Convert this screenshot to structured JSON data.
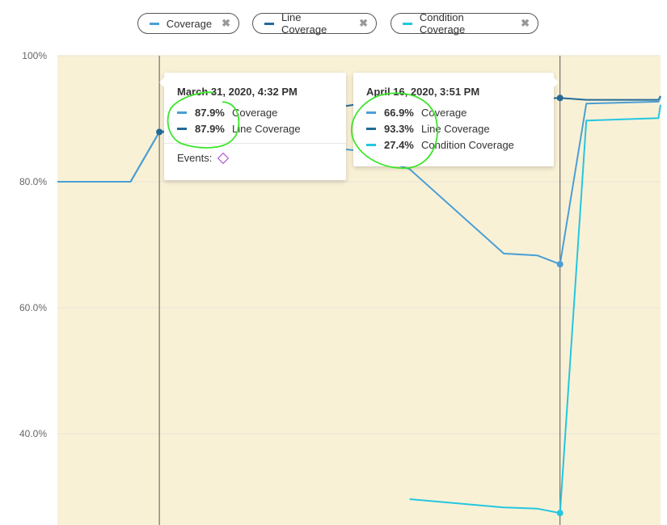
{
  "legend": [
    {
      "label": "Coverage",
      "color": "#4b9fd5",
      "remove_icon": "close-icon"
    },
    {
      "label": "Line Coverage",
      "color": "#236a97",
      "remove_icon": "close-icon"
    },
    {
      "label": "Condition Coverage",
      "color": "#24c6e0",
      "remove_icon": "close-icon"
    }
  ],
  "close_glyph": "✖",
  "tooltips": [
    {
      "date": "March 31, 2020, 4:32 PM",
      "rows": [
        {
          "value": "87.9%",
          "label": "Coverage",
          "color": "#4b9fd5"
        },
        {
          "value": "87.9%",
          "label": "Line Coverage",
          "color": "#236a97"
        }
      ],
      "events_label": "Events:",
      "event_icon": "diamond-icon"
    },
    {
      "date": "April 16, 2020, 3:51 PM",
      "rows": [
        {
          "value": "66.9%",
          "label": "Coverage",
          "color": "#4b9fd5"
        },
        {
          "value": "93.3%",
          "label": "Line Coverage",
          "color": "#236a97"
        },
        {
          "value": "27.4%",
          "label": "Condition Coverage",
          "color": "#24c6e0"
        }
      ]
    }
  ],
  "chart_data": {
    "type": "line",
    "background": "#f9f1d6",
    "ylim": [
      25.5,
      100
    ],
    "xlim": [
      "2020-03-27T15:00",
      "2020-04-20T16:00"
    ],
    "yticks": [
      {
        "value": 100,
        "label": "100%"
      },
      {
        "value": 80,
        "label": "80.0%"
      },
      {
        "value": 60,
        "label": "60.0%"
      },
      {
        "value": 40,
        "label": "40.0%"
      }
    ],
    "grid": true,
    "hover_dates": [
      "2020-03-31T16:32",
      "2020-04-16T15:51"
    ],
    "series": [
      {
        "name": "Line Coverage",
        "color": "#236a97",
        "points": [
          [
            "2020-03-27T15:00",
            80.0
          ],
          [
            "2020-03-30T13:00",
            80.0
          ],
          [
            "2020-03-31T16:32",
            87.9
          ],
          [
            "2020-04-08T11:00",
            92.2
          ],
          [
            "2020-04-16T15:51",
            93.3
          ],
          [
            "2020-04-17T17:00",
            93.0
          ],
          [
            "2020-04-20T14:00",
            93.0
          ],
          [
            "2020-04-20T16:00",
            93.6
          ]
        ]
      },
      {
        "name": "Coverage",
        "color": "#4b9fd5",
        "points": [
          [
            "2020-03-27T15:00",
            80.0
          ],
          [
            "2020-03-30T13:00",
            80.0
          ],
          [
            "2020-03-31T16:32",
            87.9
          ],
          [
            "2020-04-08T11:00",
            85.0
          ],
          [
            "2020-04-10T16:00",
            82.0
          ],
          [
            "2020-04-14T10:00",
            68.6
          ],
          [
            "2020-04-15T18:00",
            68.3
          ],
          [
            "2020-04-16T15:51",
            66.9
          ],
          [
            "2020-04-17T17:00",
            92.4
          ],
          [
            "2020-04-20T14:00",
            92.7
          ],
          [
            "2020-04-20T16:00",
            93.4
          ]
        ]
      },
      {
        "name": "Condition Coverage",
        "color": "#24c6e0",
        "points": [
          [
            "2020-04-10T16:00",
            29.6
          ],
          [
            "2020-04-14T10:00",
            28.3
          ],
          [
            "2020-04-15T18:00",
            28.1
          ],
          [
            "2020-04-16T15:51",
            27.4
          ],
          [
            "2020-04-17T17:00",
            89.7
          ],
          [
            "2020-04-20T14:00",
            90.1
          ],
          [
            "2020-04-20T16:00",
            92.2
          ]
        ]
      }
    ],
    "highlighted_points": [
      {
        "series": "Line Coverage",
        "date": "2020-03-31T16:32",
        "value": 87.9
      },
      {
        "series": "Line Coverage",
        "date": "2020-04-16T15:51",
        "value": 93.3
      },
      {
        "series": "Coverage",
        "date": "2020-04-16T15:51",
        "value": 66.9
      },
      {
        "series": "Condition Coverage",
        "date": "2020-04-16T15:51",
        "value": 27.4
      }
    ]
  }
}
